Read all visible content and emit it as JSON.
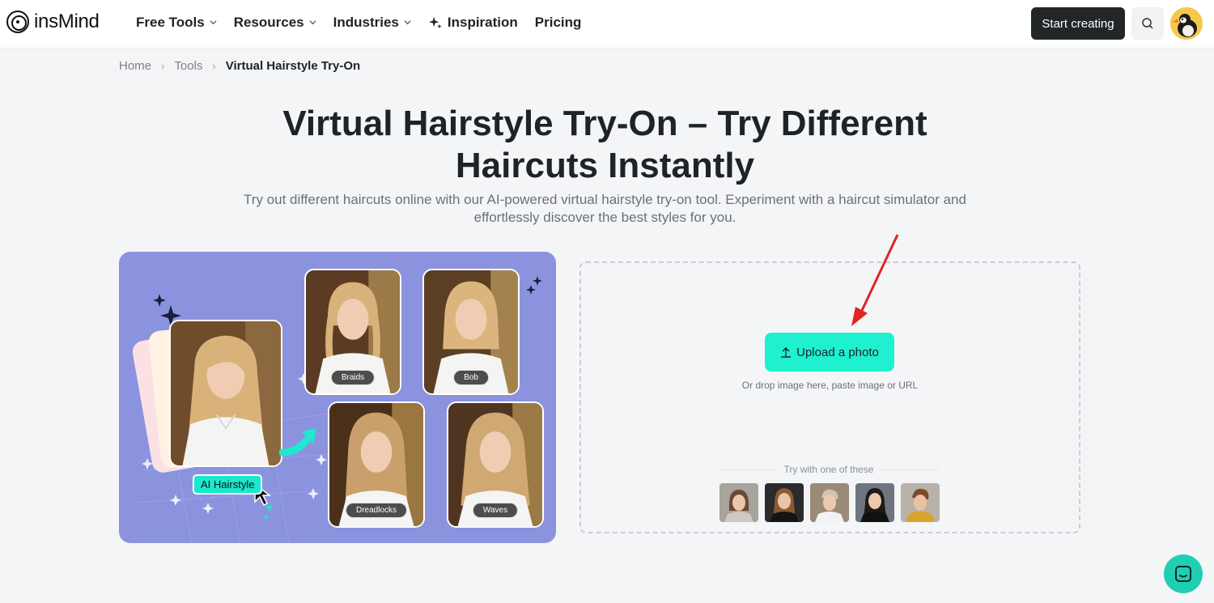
{
  "brand": {
    "name": "insMind"
  },
  "nav": {
    "items": [
      {
        "label": "Free Tools",
        "dropdown": true
      },
      {
        "label": "Resources",
        "dropdown": true
      },
      {
        "label": "Industries",
        "dropdown": true
      },
      {
        "label": "Inspiration",
        "dropdown": false
      },
      {
        "label": "Pricing",
        "dropdown": false
      }
    ],
    "cta_label": "Start creating"
  },
  "breadcrumb": [
    "Home",
    "Tools",
    "Virtual Hairstyle Try-On"
  ],
  "hero": {
    "title_line1": "Virtual Hairstyle Try-On – Try Different",
    "title_line2": "Haircuts Instantly",
    "subtitle_line1": "Try out different haircuts online with our AI-powered virtual hairstyle try-on tool. Experiment with a haircut simulator and",
    "subtitle_line2": "effortlessly discover the best styles for you."
  },
  "demo": {
    "chip": "AI Hairstyle",
    "styles": [
      "Braids",
      "Bob",
      "Dreadlocks",
      "Waves"
    ]
  },
  "upload": {
    "button_label": "Upload a photo",
    "hint": "Or drop image here, paste image or URL",
    "try_label": "Try with one of these",
    "samples": 5
  },
  "colors": {
    "accent": "#1ef0d0",
    "demo_bg": "#8b93df",
    "dark_button": "#222629",
    "annotation_arrow": "#e02424"
  }
}
